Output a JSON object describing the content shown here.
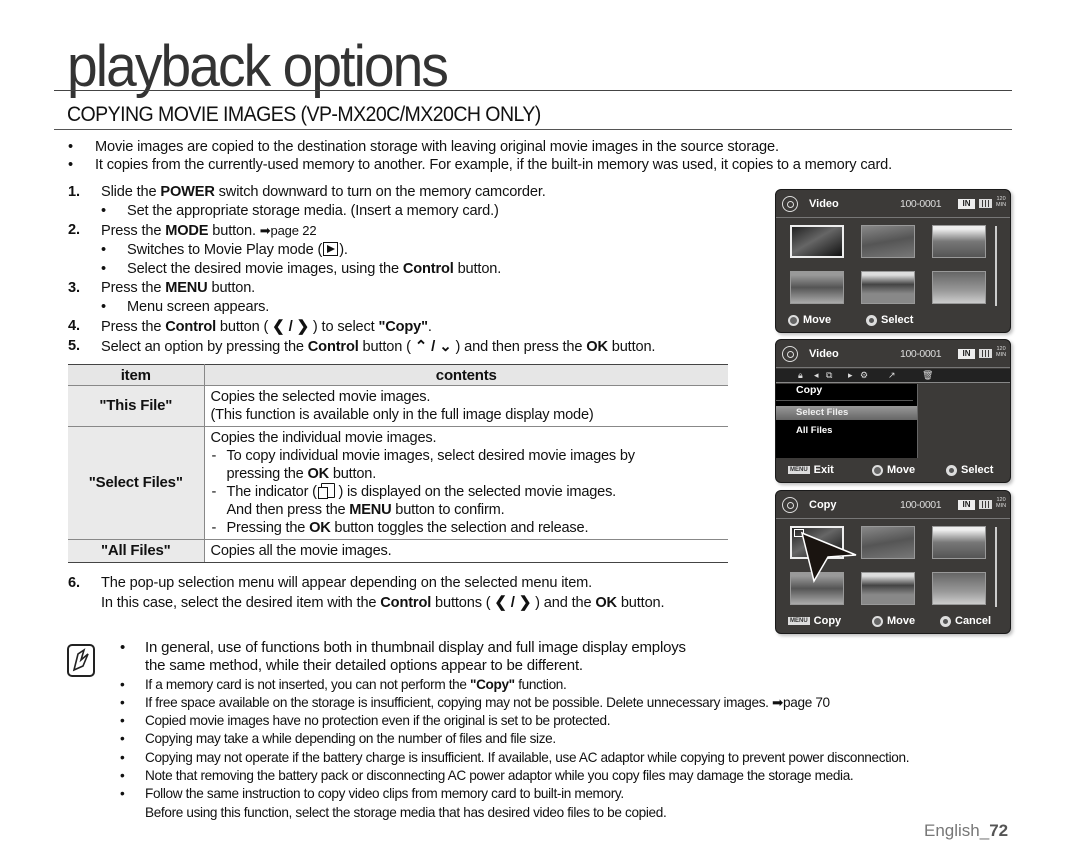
{
  "page": {
    "title": "playback options",
    "section_title": "COPYING MOVIE IMAGES (VP-MX20C/MX20CH ONLY)",
    "footer_lang": "English_",
    "footer_page": "72"
  },
  "intro": [
    "Movie images are copied to the destination storage with leaving original movie images in the source storage.",
    "It copies from the currently-used memory to another. For example, if the built-in memory was used, it copies to a memory card."
  ],
  "steps": {
    "s1": {
      "num": "1.",
      "pre": "Slide the ",
      "bold": "POWER",
      "post": " switch downward to turn on the memory camcorder.",
      "sub1": "Set the appropriate storage media. (Insert a memory card.)"
    },
    "s2": {
      "num": "2.",
      "pre": "Press the ",
      "bold": "MODE",
      "post": " button. ",
      "ref": "➡page 22",
      "sub1_pre": "Switches to Movie Play mode (",
      "sub1_post": ").",
      "sub2_pre": "Select the desired movie images, using the ",
      "sub2_bold": "Control",
      "sub2_post": " button."
    },
    "s3": {
      "num": "3.",
      "pre": "Press the ",
      "bold": "MENU",
      "post": " button.",
      "sub1": "Menu screen appears."
    },
    "s4": {
      "num": "4.",
      "pre": "Press the ",
      "bold": "Control",
      "mid": " button ( ",
      "chev": "❮ / ❯",
      "mid2": " ) to select ",
      "bold2": "\"Copy\"",
      "post": "."
    },
    "s5": {
      "num": "5.",
      "pre": "Select an option by pressing the ",
      "bold": "Control",
      "mid": " button ( ",
      "chev": "⌃ / ⌄",
      "mid2": " ) and then press the ",
      "bold2": "OK",
      "post": " button."
    },
    "s6": {
      "num": "6.",
      "line1": "The pop-up selection menu will appear depending on the selected menu item.",
      "line2_pre": "In this case, select the desired item with the ",
      "line2_bold": "Control",
      "line2_mid": " buttons ( ",
      "chev": "❮ / ❯",
      "line2_mid2": " ) and the ",
      "line2_bold2": "OK",
      "line2_post": " button."
    }
  },
  "table": {
    "headers": [
      "item",
      "contents"
    ],
    "rows": {
      "this_file": {
        "item": "\"This File\"",
        "l1": "Copies the selected movie images.",
        "l2": "(This function is available only in the full image display mode)"
      },
      "select_files": {
        "item": "\"Select Files\"",
        "l1": "Copies the individual movie images.",
        "d1": "To copy individual movie images, select desired movie images by",
        "d1b_pre": "pressing the ",
        "d1b_bold": "OK",
        "d1b_post": " button.",
        "d2_pre": "The indicator ( ",
        "d2_post": " ) is displayed on the selected movie images.",
        "d2b_pre": "And then press the ",
        "d2b_bold": "MENU",
        "d2b_post": " button to confirm.",
        "d3_pre": "Pressing the ",
        "d3_bold": "OK",
        "d3_post": " button toggles the selection and release."
      },
      "all_files": {
        "item": "\"All Files\"",
        "l1": "Copies all the movie images."
      }
    }
  },
  "notes": {
    "n1a": "In general, use of functions both in thumbnail display and full image display employs",
    "n1b": "the same method, while their detailed options appear to be different.",
    "n2_pre": "If a memory card is not inserted, you can not perform the ",
    "n2_bold": "\"Copy\"",
    "n2_post": " function.",
    "n3": "If free space available on the storage is insufficient, copying may not be possible. Delete unnecessary images. ➡page 70",
    "n4": "Copied movie images have no protection even if the original is set to be protected.",
    "n5": "Copying may take a while depending on the number of files and file size.",
    "n6": "Copying may not operate if the battery charge is insufficient. If available, use AC adaptor while copying to prevent power disconnection.",
    "n7": "Note that removing the battery pack or disconnecting AC power adaptor while you copy files may damage the storage media.",
    "n8a": "Follow the same instruction to copy video clips from memory card to built-in memory.",
    "n8b": "Before using this function, select the storage media that has desired video files to be copied."
  },
  "screens": {
    "status": {
      "file_no": "100-0001",
      "storage": "IN",
      "remaining_top": "120",
      "remaining_unit": "MIN"
    },
    "s1": {
      "title": "Video",
      "foot_move": "Move",
      "foot_select": "Select"
    },
    "s2": {
      "title": "Video",
      "menu_title": "Copy",
      "options": [
        "Select Files",
        "All Files"
      ],
      "selected": "Select Files",
      "menu_key": "MENU",
      "foot_exit": "Exit",
      "foot_move": "Move",
      "foot_select": "Select"
    },
    "s3": {
      "title": "Copy",
      "menu_key": "MENU",
      "foot_copy": "Copy",
      "foot_move": "Move",
      "foot_cancel": "Cancel"
    }
  }
}
